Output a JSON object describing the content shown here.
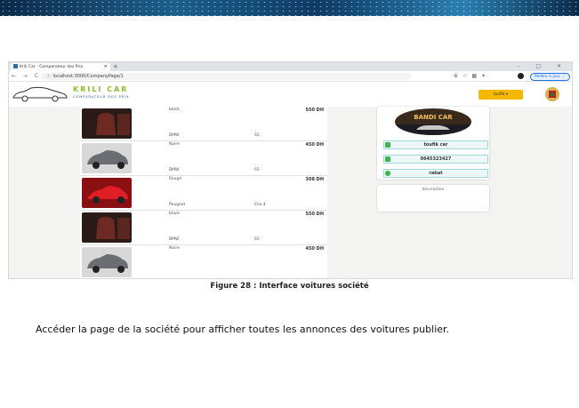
{
  "browser": {
    "tab_title": "Krili Car - Comparateur des Prix",
    "tab_close": "×",
    "new_tab": "+",
    "window_controls": "– □ ✕",
    "nav_buttons": "← → C",
    "url": "localhost:3000/CompanyPage/1",
    "update_button": "Mettre à jour ⋮"
  },
  "site": {
    "brand": "KRILI CAR",
    "brand_sub": "COMPARATEUR DES PRIX",
    "user_button": "toufik ▾"
  },
  "listings": [
    {
      "color": "black",
      "price": "550 DH",
      "brand": "BMW",
      "model": "S5",
      "thumb": "interior"
    },
    {
      "color": "Noire",
      "price": "450 DH",
      "brand": "BMW",
      "model": "S5",
      "thumb": "silver"
    },
    {
      "color": "Rouge",
      "price": "308 DH",
      "brand": "Peugeot",
      "model": "Clio 4",
      "thumb": "red"
    },
    {
      "color": "black",
      "price": "550 DH",
      "brand": "BMW",
      "model": "S5",
      "thumb": "interior"
    },
    {
      "color": "Noire",
      "price": "450 DH",
      "brand": "",
      "model": "",
      "thumb": "silver"
    }
  ],
  "company": {
    "logo_text": "BANDI CAR",
    "name": "toufik car",
    "phone": "0645323427",
    "city": "rabat",
    "description": "description"
  },
  "caption": "Figure 28 : Interface voitures société",
  "paragraph": "Accéder la page de la société pour afficher toutes les annonces des voitures publier.",
  "colors": {
    "brand_green": "#8bbf2a",
    "accent_yellow": "#f5b800",
    "icon_green": "#3bb54a"
  }
}
